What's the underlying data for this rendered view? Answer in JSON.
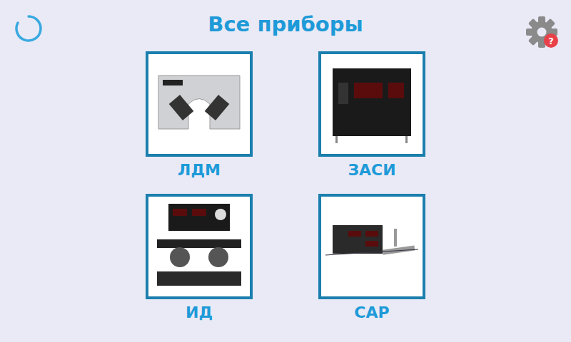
{
  "title": "Все приборы",
  "settings": {
    "badge": "?"
  },
  "devices": [
    {
      "label": "ЛДМ"
    },
    {
      "label": "ЗАСИ"
    },
    {
      "label": "ИД"
    },
    {
      "label": "САР"
    }
  ]
}
